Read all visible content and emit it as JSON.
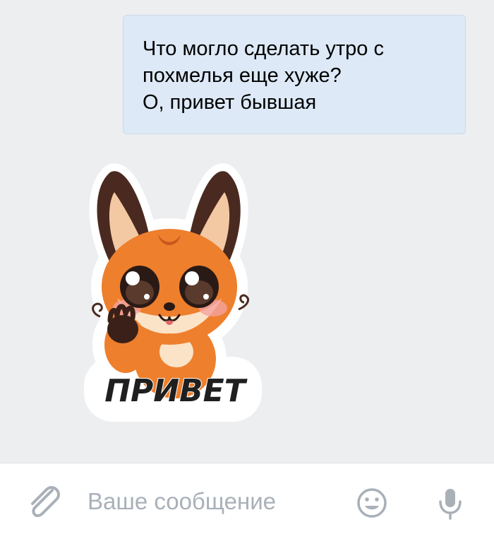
{
  "message": {
    "lines": [
      "Что могло сделать утро с",
      "похмелья еще хуже?",
      "О, привет бывшая"
    ]
  },
  "sticker": {
    "caption": "ПРИВЕТ",
    "character": "fox"
  },
  "composer": {
    "placeholder": "Ваше сообщение",
    "attach_icon": "paperclip-icon",
    "emoji_icon": "smiley-icon",
    "mic_icon": "microphone-icon"
  },
  "colors": {
    "chat_background": "#edeef0",
    "bubble_background": "#dde9f6",
    "icon_gray": "#a9b0b8"
  }
}
